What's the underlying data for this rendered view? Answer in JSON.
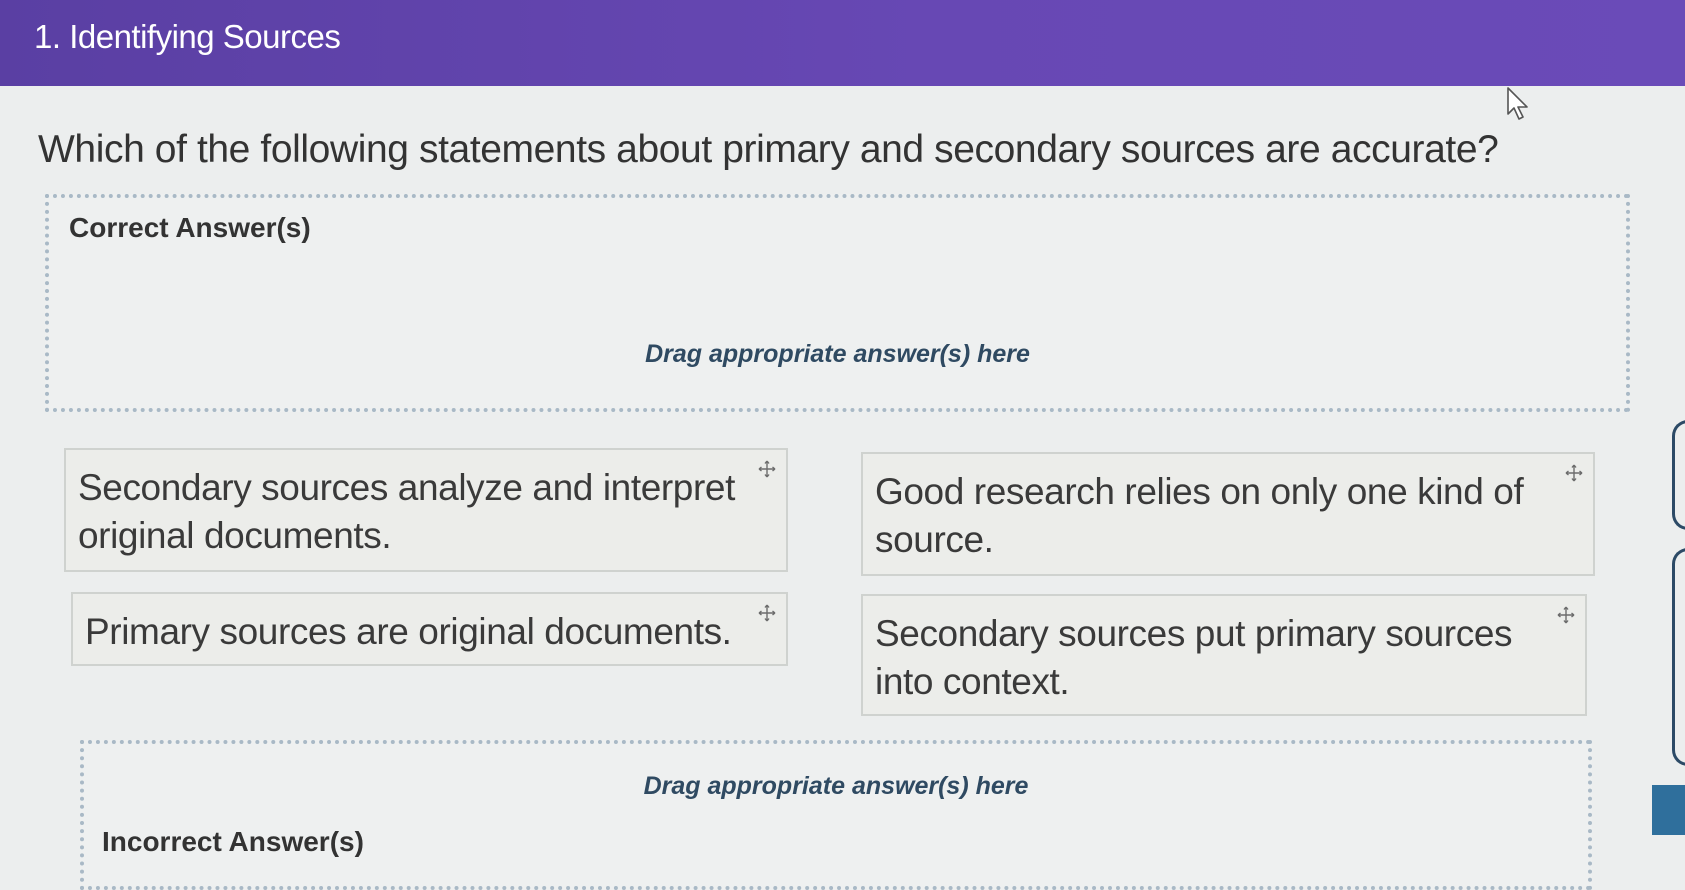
{
  "header": {
    "title": "1. Identifying Sources"
  },
  "question": {
    "text": "Which of the following statements about primary and secondary sources are accurate?"
  },
  "correct_zone": {
    "title": "Correct Answer(s)",
    "hint": "Drag appropriate answer(s) here"
  },
  "incorrect_zone": {
    "title": "Incorrect Answer(s)",
    "hint": "Drag appropriate answer(s) here"
  },
  "cards": [
    {
      "text": "Secondary sources analyze and interpret original documents.",
      "icon": "move-icon"
    },
    {
      "text": "Good research relies on only one kind of source.",
      "icon": "move-icon"
    },
    {
      "text": "Primary sources are original documents.",
      "icon": "move-icon"
    },
    {
      "text": "Secondary sources put primary sources into context.",
      "icon": "move-icon"
    }
  ],
  "colors": {
    "header": "#6247b0",
    "hint_text": "#2f4a62",
    "side_tab": "#2f6f9c"
  }
}
